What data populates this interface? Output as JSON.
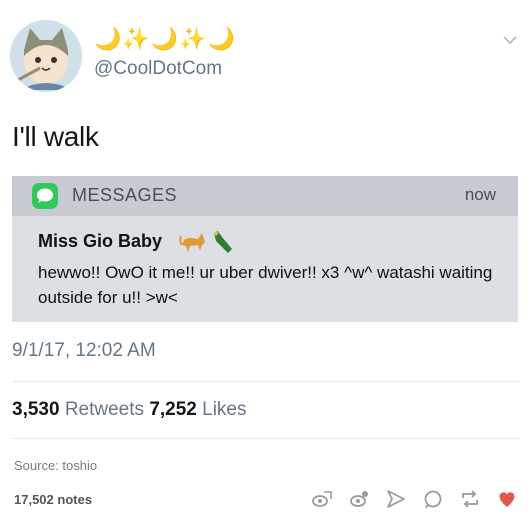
{
  "header": {
    "display_name": "🌙✨🌙✨🌙",
    "handle": "@CoolDotCom"
  },
  "tweet": {
    "text": "I'll walk",
    "notification": {
      "app_name": "MESSAGES",
      "time": "now",
      "sender": "Miss Gio Baby",
      "message": "hewwo!! OwO it me!! ur uber dwiver!! x3 ^w^ watashi waiting outside for u!! >w<"
    },
    "timestamp": "9/1/17, 12:02 AM",
    "stats": {
      "retweets_count": "3,530",
      "retweets_label": "Retweets",
      "likes_count": "7,252",
      "likes_label": "Likes"
    }
  },
  "post_footer": {
    "source": "Source: toshio",
    "notes": "17,502 notes"
  },
  "colors": {
    "accent_like": "#e2584a",
    "message_app": "#34c759",
    "muted_text": "#657786"
  },
  "icons": [
    "chevron-down-icon",
    "messages-app-icon",
    "cat-emoji-icon",
    "bottle-emoji-icon",
    "hide-icon",
    "view-icon",
    "share-icon",
    "reply-icon",
    "reblog-icon",
    "like-heart-icon"
  ]
}
